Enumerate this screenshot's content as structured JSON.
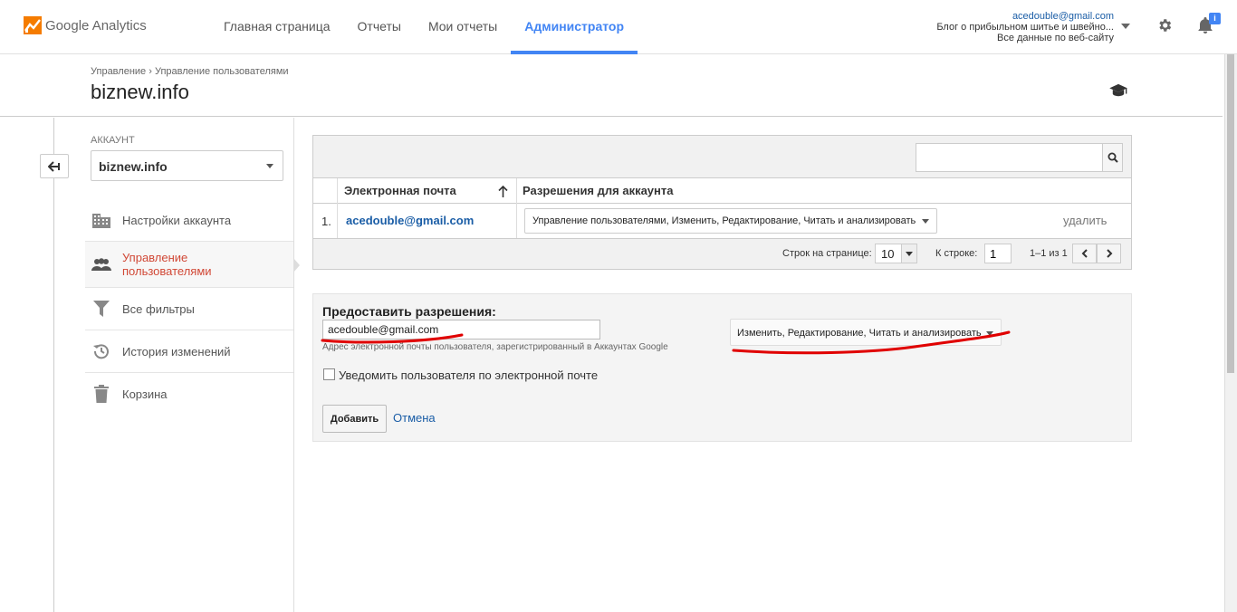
{
  "app": {
    "logo_text": "Google Analytics",
    "nav": [
      {
        "label": "Главная страница"
      },
      {
        "label": "Отчеты"
      },
      {
        "label": "Мои отчеты"
      },
      {
        "label": "Администратор",
        "active": true
      }
    ],
    "account": {
      "email": "acedouble@gmail.com",
      "property": "Блог о прибыльном шитье и швейно...",
      "view": "Все данные по веб-сайту"
    },
    "notification_badge": "i",
    "accent_color": "#4285f4"
  },
  "header": {
    "breadcrumb": [
      "Управление",
      "Управление пользователями"
    ],
    "breadcrumb_sep": "›",
    "title": "biznew.info"
  },
  "sidebar": {
    "account_label": "АККАУНТ",
    "account_value": "biznew.info",
    "items": [
      {
        "label": "Настройки аккаунта",
        "icon": "building-icon"
      },
      {
        "label": "Управление пользователями",
        "icon": "people-icon",
        "active": true
      },
      {
        "label": "Все фильтры",
        "icon": "filter-icon"
      },
      {
        "label": "История изменений",
        "icon": "history-icon"
      },
      {
        "label": "Корзина",
        "icon": "trash-icon"
      }
    ]
  },
  "users_table": {
    "search_placeholder": "",
    "columns": [
      "Электронная почта",
      "Разрешения для аккаунта"
    ],
    "rows": [
      {
        "num": "1.",
        "email": "acedouble@gmail.com",
        "permissions": "Управление пользователями, Изменить, Редактирование, Читать и анализировать",
        "delete": "удалить"
      }
    ],
    "pager": {
      "rows_label": "Строк на странице:",
      "rows_value": "10",
      "goto_label": "К строке:",
      "goto_value": "1",
      "range": "1–1 из 1"
    }
  },
  "grant": {
    "title": "Предоставить разрешения:",
    "email_value": "acedouble@gmail.com",
    "hint": "Адрес электронной почты пользователя, зарегистрированный в Аккаунтах Google",
    "permissions_value": "Изменить, Редактирование, Читать и анализировать",
    "notify_label": "Уведомить пользователя по электронной почте",
    "notify_checked": false,
    "add_label": "Добавить",
    "cancel_label": "Отмена"
  },
  "annotation_color": "#e00000"
}
